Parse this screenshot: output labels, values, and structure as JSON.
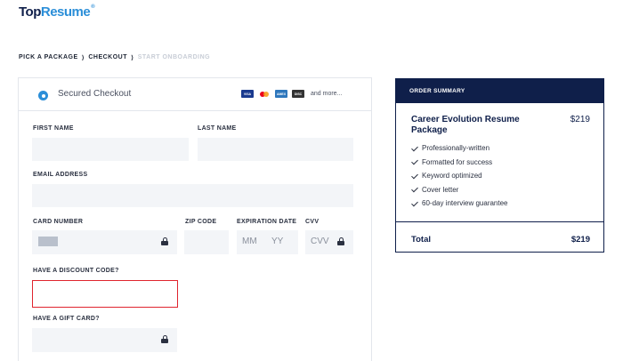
{
  "brand": {
    "part1": "Top",
    "part2": "Resume",
    "mark": "®"
  },
  "breadcrumb": {
    "step1": "PICK A PACKAGE",
    "sep": "⟩",
    "step2": "CHECKOUT",
    "step3": "START ONBOARDING"
  },
  "checkout": {
    "title": "Secured Checkout",
    "cards": {
      "visa": "VISA",
      "amex": "AMEX",
      "discover": "DISC",
      "more": "and more..."
    },
    "first_name_label": "FIRST NAME",
    "last_name_label": "LAST NAME",
    "email_label": "EMAIL ADDRESS",
    "card_number_label": "CARD NUMBER",
    "zip_label": "ZIP CODE",
    "expiration_label": "EXPIRATION DATE",
    "cvv_label": "CVV",
    "mm_placeholder": "MM",
    "yy_placeholder": "YY",
    "cvv_placeholder": "CVV",
    "discount_label": "HAVE A DISCOUNT CODE?",
    "gift_label": "HAVE A GIFT CARD?"
  },
  "summary": {
    "header": "ORDER SUMMARY",
    "package_name": "Career Evolution Resume Package",
    "package_price": "$219",
    "features": [
      "Professionally-written",
      "Formatted for success",
      "Keyword optimized",
      "Cover letter",
      "60-day interview guarantee"
    ],
    "total_label": "Total",
    "total_value": "$219"
  },
  "colors": {
    "navy": "#0f1f4a",
    "accent": "#2b8ed8",
    "error": "#e0242e",
    "field": "#f3f5f8"
  }
}
